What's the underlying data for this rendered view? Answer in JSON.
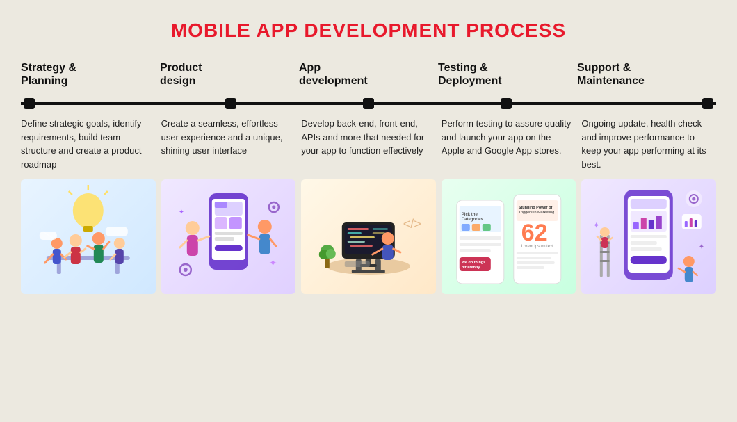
{
  "page": {
    "title": "MOBILE APP DEVELOPMENT PROCESS",
    "background_color": "#ece9e0",
    "accent_color": "#e8192c"
  },
  "steps": [
    {
      "id": "strategy",
      "title": "Strategy &\nPlanning",
      "description": "Define strategic goals, identify requirements, build team structure and create a product roadmap",
      "illustration_label": "strategy-illustration"
    },
    {
      "id": "product-design",
      "title": "Product\ndesign",
      "description": "Create a seamless, effortless user experience and a unique, shining user interface",
      "illustration_label": "product-design-illustration"
    },
    {
      "id": "app-development",
      "title": "App\ndevelopment",
      "description": "Develop back-end, front-end, APIs and more that needed for your app to function effectively",
      "illustration_label": "app-development-illustration"
    },
    {
      "id": "testing",
      "title": "Testing &\nDeployment",
      "description": "Perform testing to assure quality and launch your app on the Apple and Google App stores.",
      "illustration_label": "testing-illustration"
    },
    {
      "id": "support",
      "title": "Support &\nMaintenance",
      "description": "Ongoing update, health check and improve performance to keep your app performing at its best.",
      "illustration_label": "support-illustration"
    }
  ]
}
